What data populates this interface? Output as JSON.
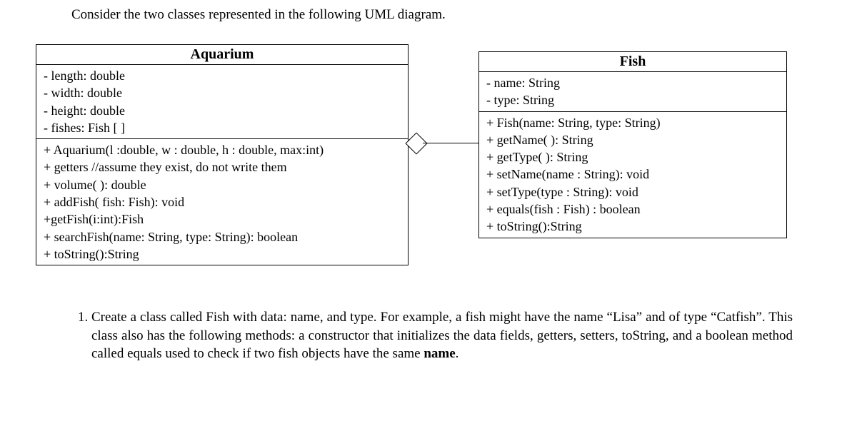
{
  "intro": "Consider the two classes represented in the following UML diagram.",
  "aquarium": {
    "title": "Aquarium",
    "attributes": [
      "- length: double",
      "- width: double",
      "- height: double",
      "- fishes: Fish [ ]"
    ],
    "methods": [
      "+ Aquarium(l :double, w : double, h : double, max:int)",
      "+ getters //assume they exist, do not write them",
      "+ volume( ): double",
      "+ addFish( fish: Fish): void",
      "+getFish(i:int):Fish",
      "+ searchFish(name: String, type: String): boolean",
      "+ toString():String"
    ]
  },
  "fish": {
    "title": "Fish",
    "attributes": [
      "- name: String",
      "- type: String"
    ],
    "methods": [
      "+ Fish(name: String, type: String)",
      "+ getName( ): String",
      "+ getType( ): String",
      "+ setName(name : String): void",
      "+ setType(type : String): void",
      "+ equals(fish : Fish) : boolean",
      "+ toString():String"
    ]
  },
  "question1": {
    "number": "1.",
    "text_before_bold": "Create a class called Fish with data: name, and type.  For example, a fish might have the name “Lisa” and of type “Catfish”. This class also has the following methods: a constructor that initializes the data fields, getters, setters, toString, and a boolean method called equals used to check if two fish objects have the same ",
    "bold_word": "name",
    "text_after_bold": "."
  }
}
